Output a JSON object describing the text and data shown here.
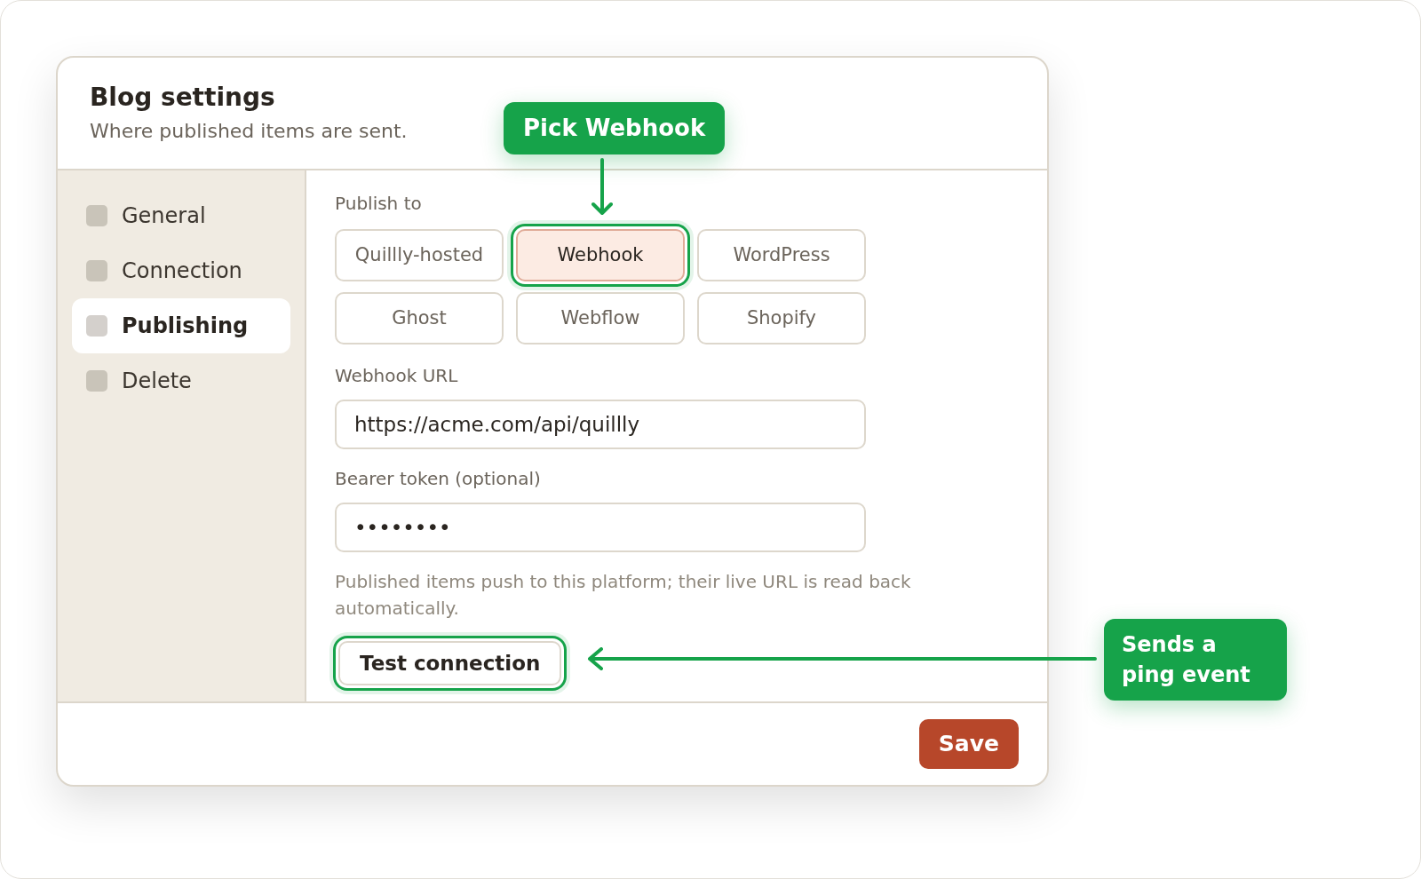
{
  "dialog": {
    "title": "Blog settings",
    "subtitle": "Where published items are sent."
  },
  "sidebar": {
    "items": [
      {
        "label": "General",
        "selected": false
      },
      {
        "label": "Connection",
        "selected": false
      },
      {
        "label": "Publishing",
        "selected": true
      },
      {
        "label": "Delete",
        "selected": false
      }
    ]
  },
  "publish_to": {
    "label": "Publish to",
    "options": [
      {
        "label": "Quillly-hosted",
        "selected": false,
        "highlighted": false
      },
      {
        "label": "Webhook",
        "selected": true,
        "highlighted": true
      },
      {
        "label": "WordPress",
        "selected": false,
        "highlighted": false
      },
      {
        "label": "Ghost",
        "selected": false,
        "highlighted": false
      },
      {
        "label": "Webflow",
        "selected": false,
        "highlighted": false
      },
      {
        "label": "Shopify",
        "selected": false,
        "highlighted": false
      }
    ]
  },
  "webhook_url": {
    "label": "Webhook URL",
    "value": "https://acme.com/api/quillly"
  },
  "bearer_token": {
    "label": "Bearer token (optional)",
    "value": "••••••••"
  },
  "help": "Published items push to this platform; their live URL is read back automatically.",
  "test_button": {
    "label": "Test connection",
    "highlighted": true
  },
  "save_button": "Save",
  "callouts": [
    {
      "kind": "down",
      "text": "Pick Webhook"
    },
    {
      "kind": "left",
      "text": "Sends a ping event"
    }
  ]
}
